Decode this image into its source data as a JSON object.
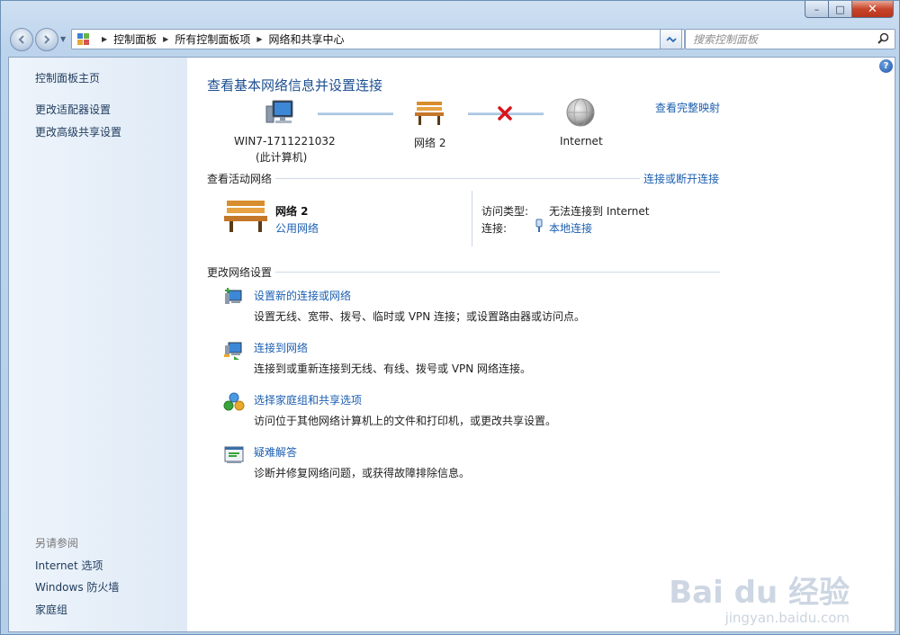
{
  "window": {
    "controls": {
      "minimize": "–",
      "maximize": "□",
      "close": "✕"
    }
  },
  "address": {
    "breadcrumbs": [
      "控制面板",
      "所有控制面板项",
      "网络和共享中心"
    ],
    "search_placeholder": "搜索控制面板"
  },
  "sidebar": {
    "home": "控制面板主页",
    "links": [
      "更改适配器设置",
      "更改高级共享设置"
    ],
    "see_also_title": "另请参阅",
    "see_also": [
      "Internet 选项",
      "Windows 防火墙",
      "家庭组"
    ]
  },
  "main": {
    "title": "查看基本网络信息并设置连接",
    "full_map_link": "查看完整映射",
    "map": {
      "computer_name": "WIN7-1711221032",
      "computer_sub": "(此计算机)",
      "network_name": "网络  2",
      "internet": "Internet"
    },
    "active": {
      "section_title": "查看活动网络",
      "section_link": "连接或断开连接",
      "network_name": "网络  2",
      "network_type": "公用网络",
      "access_key": "访问类型:",
      "access_value": "无法连接到 Internet",
      "conn_key": "连接:",
      "conn_value": "本地连接"
    },
    "change": {
      "section_title": "更改网络设置",
      "tasks": [
        {
          "title": "设置新的连接或网络",
          "desc": "设置无线、宽带、拨号、临时或 VPN 连接；或设置路由器或访问点。",
          "icon": "new-connection-icon"
        },
        {
          "title": "连接到网络",
          "desc": "连接到或重新连接到无线、有线、拨号或 VPN 网络连接。",
          "icon": "connect-network-icon"
        },
        {
          "title": "选择家庭组和共享选项",
          "desc": "访问位于其他网络计算机上的文件和打印机，或更改共享设置。",
          "icon": "homegroup-icon"
        },
        {
          "title": "疑难解答",
          "desc": "诊断并修复网络问题，或获得故障排除信息。",
          "icon": "troubleshoot-icon"
        }
      ]
    }
  },
  "watermark": {
    "logo": "Bai du 经验",
    "url": "jingyan.baidu.com"
  },
  "colors": {
    "link": "#1c5fb0",
    "title": "#1d4f91",
    "error": "#d9141b"
  }
}
